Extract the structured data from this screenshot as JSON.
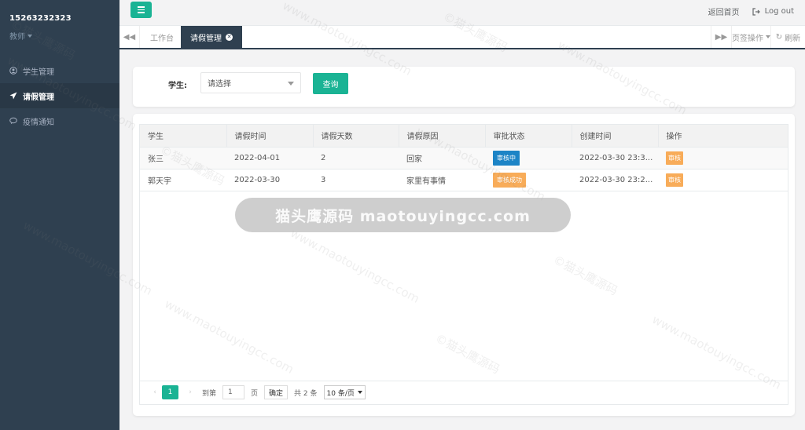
{
  "sidebar": {
    "user": "15263232323",
    "role": "教师",
    "items": [
      {
        "label": "学生管理",
        "icon": "user-circle-icon"
      },
      {
        "label": "请假管理",
        "icon": "paper-plane-icon"
      },
      {
        "label": "疫情通知",
        "icon": "comment-icon"
      }
    ]
  },
  "topbar": {
    "home_link": "返回首页",
    "logout": "Log out"
  },
  "tabs": {
    "items": [
      {
        "label": "工作台"
      },
      {
        "label": "请假管理"
      }
    ],
    "tab_ops": "页签操作",
    "refresh": "刷新"
  },
  "search": {
    "label": "学生:",
    "placeholder": "请选择",
    "button": "查询"
  },
  "table": {
    "headers": [
      "学生",
      "请假时间",
      "请假天数",
      "请假原因",
      "审批状态",
      "创建时间",
      "操作"
    ],
    "rows": [
      {
        "student": "张三",
        "date": "2022-04-01",
        "days": "2",
        "reason": "回家",
        "status": "审核中",
        "created": "2022-03-30 23:3...",
        "action": "审核"
      },
      {
        "student": "郭天宇",
        "date": "2022-03-30",
        "days": "3",
        "reason": "家里有事情",
        "status": "审核成功",
        "created": "2022-03-30 23:2...",
        "action": "审核"
      }
    ]
  },
  "pager": {
    "current": "1",
    "goto_label": "到第",
    "goto_value": "1",
    "page_unit": "页",
    "ok": "确定",
    "total": "共 2 条",
    "page_size": "10 条/页"
  },
  "watermark": {
    "banner": "猫头鹰源码 maotouyingcc.com",
    "tile1": "©猫头鹰源码",
    "tile2": "www.maotouyingcc.com"
  },
  "colors": {
    "sidebar_bg": "#2f4050",
    "accent": "#1ab394",
    "status_pending": "#1c84c6",
    "status_success": "#f8ac59"
  }
}
